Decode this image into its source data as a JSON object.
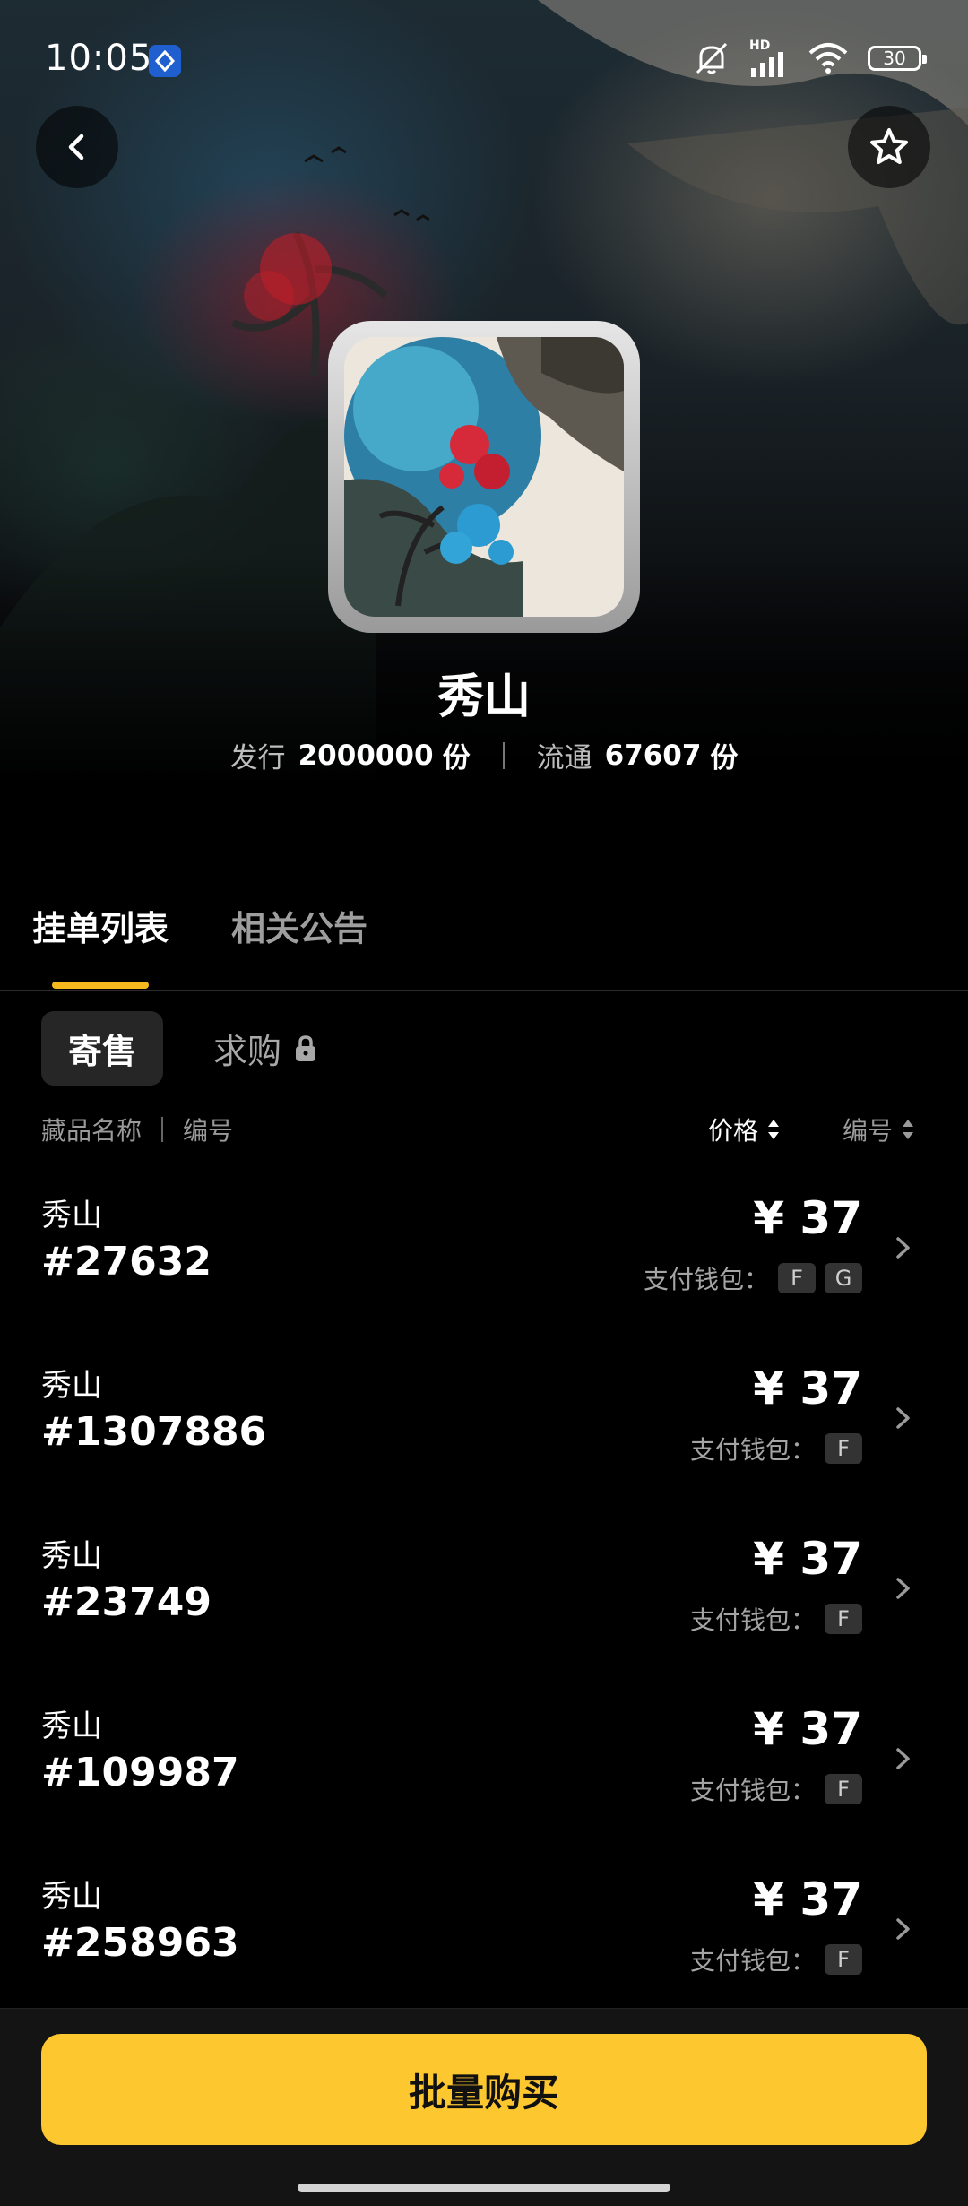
{
  "status_bar": {
    "time": "10:05",
    "battery": "30",
    "network_label": "HD"
  },
  "collection": {
    "title": "秀山",
    "issued_label": "发行",
    "issued_value": "2000000",
    "issued_unit": "份",
    "circulation_label": "流通",
    "circulation_value": "67607",
    "circulation_unit": "份"
  },
  "tabs": [
    {
      "label": "挂单列表",
      "active": true
    },
    {
      "label": "相关公告",
      "active": false
    }
  ],
  "subtabs": [
    {
      "label": "寄售",
      "active": true
    },
    {
      "label": "求购",
      "active": false,
      "locked": true
    }
  ],
  "list_header": {
    "name_label": "藏品名称",
    "number_label": "编号",
    "sort_price_label": "价格",
    "sort_number_label": "编号"
  },
  "listings": [
    {
      "name": "秀山",
      "number": "#27632",
      "price": "¥ 37",
      "wallet_label": "支付钱包：",
      "wallets": [
        "F",
        "G"
      ]
    },
    {
      "name": "秀山",
      "number": "#1307886",
      "price": "¥ 37",
      "wallet_label": "支付钱包：",
      "wallets": [
        "F"
      ]
    },
    {
      "name": "秀山",
      "number": "#23749",
      "price": "¥ 37",
      "wallet_label": "支付钱包：",
      "wallets": [
        "F"
      ]
    },
    {
      "name": "秀山",
      "number": "#109987",
      "price": "¥ 37",
      "wallet_label": "支付钱包：",
      "wallets": [
        "F"
      ]
    },
    {
      "name": "秀山",
      "number": "#258963",
      "price": "¥ 37",
      "wallet_label": "支付钱包：",
      "wallets": [
        "F"
      ]
    }
  ],
  "bottom": {
    "buy_button_label": "批量购买"
  },
  "colors": {
    "accent_yellow": "#fdc730",
    "tab_indicator": "#f5b81e",
    "background": "#000000"
  },
  "icons": [
    "back-icon",
    "star-icon",
    "lock-icon",
    "sort-icon",
    "chevron-right-icon",
    "wifi-icon",
    "signal-icon",
    "mute-icon"
  ]
}
